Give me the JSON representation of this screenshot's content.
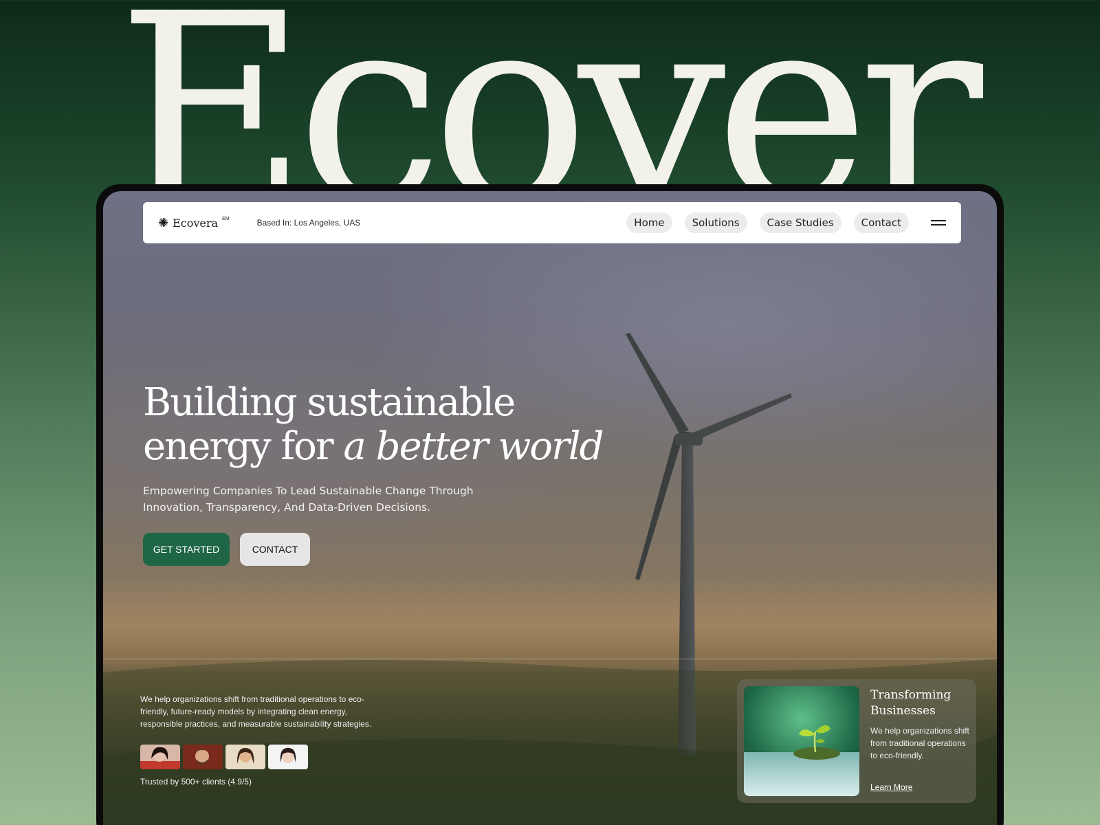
{
  "brand": {
    "big_logo": "Ecovera",
    "name": "Ecovera",
    "tm": "EM",
    "based_in": "Based In: Los Angeles, UAS"
  },
  "nav": {
    "items": [
      {
        "label": "Home"
      },
      {
        "label": "Solutions"
      },
      {
        "label": "Case Studies"
      },
      {
        "label": "Contact"
      }
    ]
  },
  "hero": {
    "title_line1": "Building sustainable",
    "title_line2_plain": "energy for ",
    "title_line2_italic": "a better world",
    "subtitle": "Empowering Companies To Lead Sustainable Change Through Innovation, Transparency, And Data-Driven Decisions.",
    "cta_primary": "GET STARTED",
    "cta_secondary": "CONTACT"
  },
  "about": {
    "text": "We help organizations shift from traditional operations to eco-friendly, future-ready models by integrating clean energy, responsible practices, and measurable sustainability strategies.",
    "trusted": "Trusted by 500+ clients (4.9/5)"
  },
  "card": {
    "title": "Transforming Businesses",
    "description": "We help organizations shift from traditional operations to eco-friendly.",
    "link": "Learn More"
  },
  "colors": {
    "primary_green": "#1e6645",
    "background_top": "#0d2a19",
    "background_bottom": "#9bbb93",
    "logo_cream": "#f3f2ea"
  }
}
